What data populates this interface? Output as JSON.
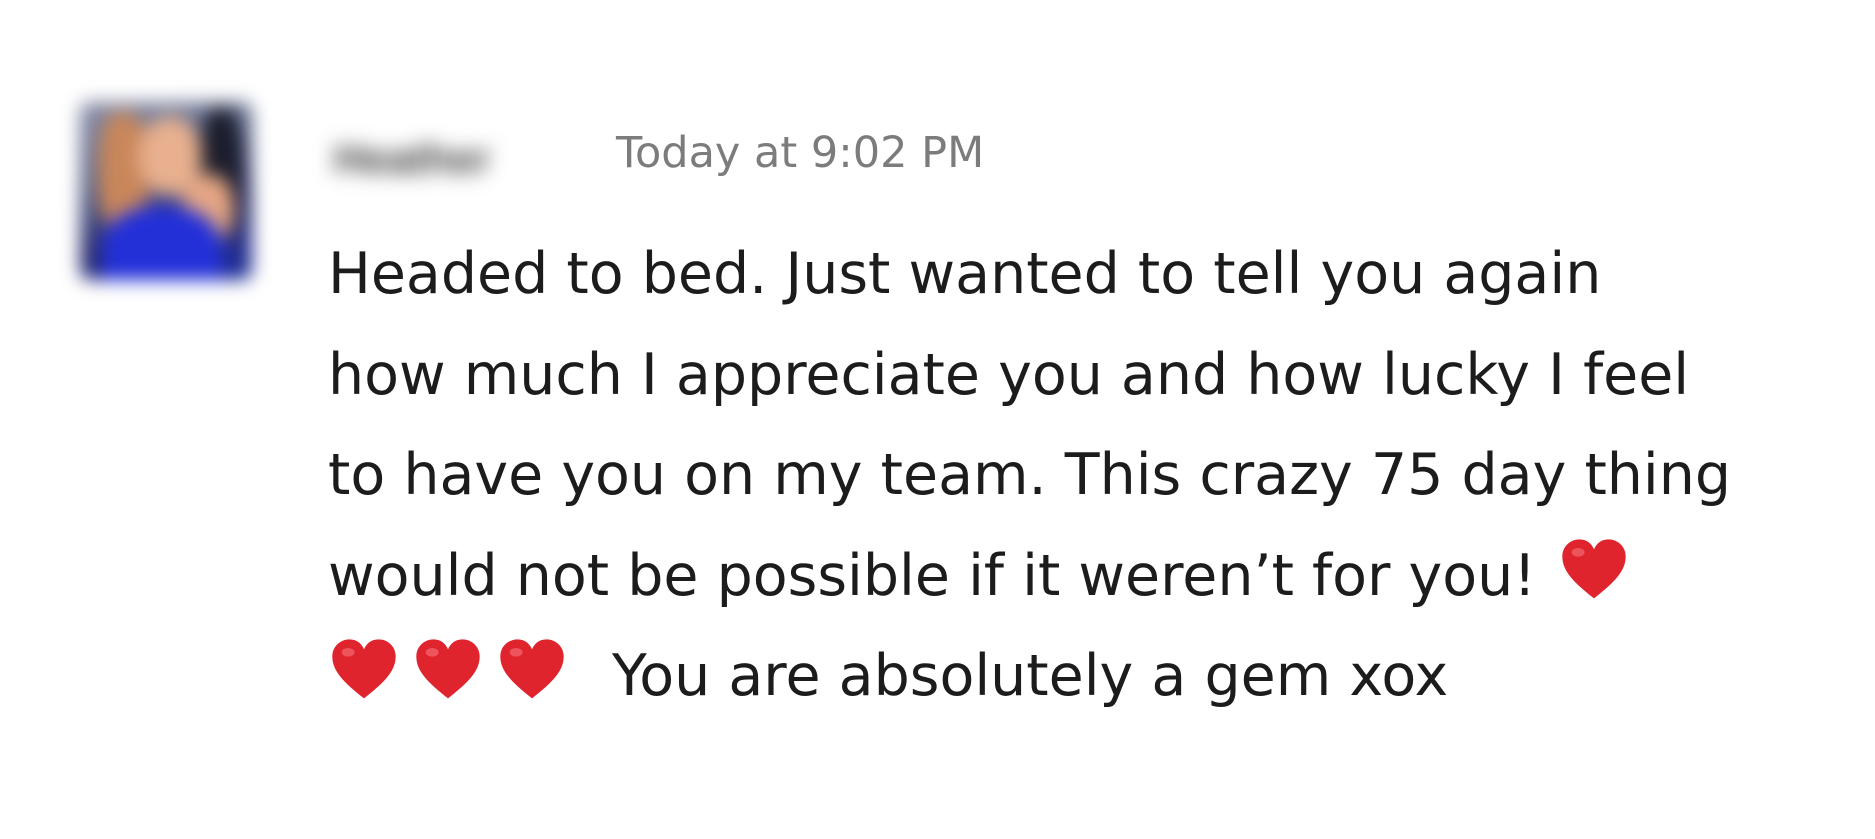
{
  "message": {
    "sender": "Heather",
    "timestamp": "Today at 9:02 PM",
    "lines": [
      "Headed to bed. Just wanted to tell you again",
      "how much I appreciate you and how lucky I feel",
      "to have you on my team. This crazy 75 day thing",
      "would not be possible if it weren’t for you!",
      "You are absolutely a gem xox"
    ],
    "emoji": [
      "red-heart",
      "red-heart",
      "red-heart",
      "red-heart"
    ]
  },
  "colors": {
    "text": "#1d1c1d",
    "timestamp": "#7c7c7c",
    "heart": "#e0242e",
    "background": "#ffffff"
  }
}
